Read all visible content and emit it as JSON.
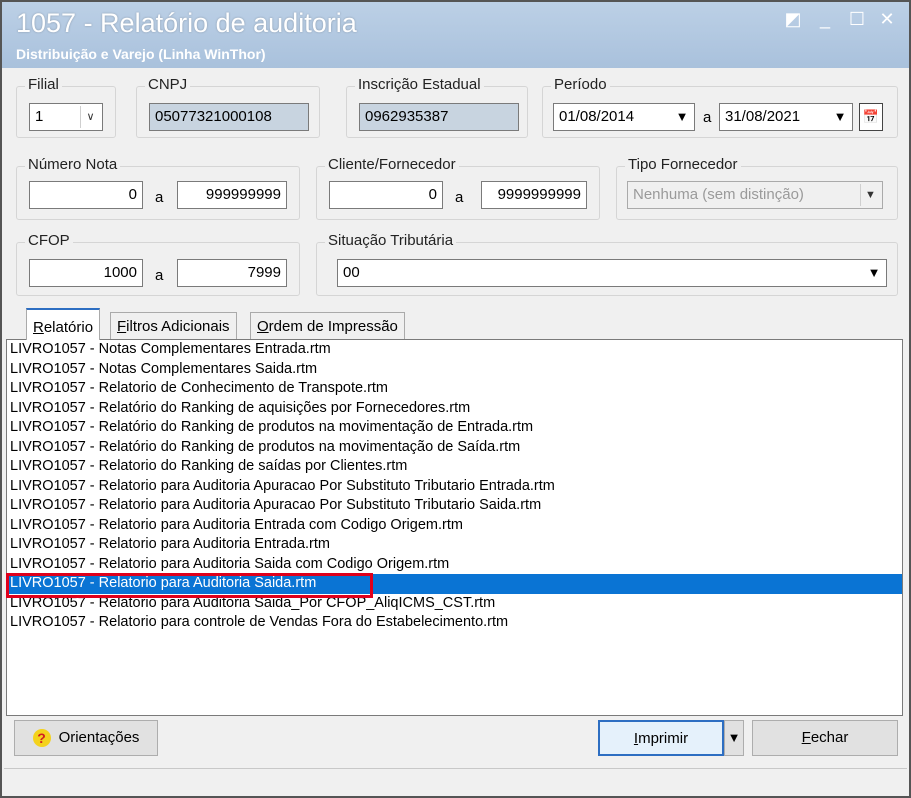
{
  "window": {
    "title": "1057 - Relatório de auditoria",
    "subtitle": "Distribuição e Varejo (Linha WinThor)"
  },
  "filial": {
    "label": "Filial",
    "value": "1"
  },
  "cnpj": {
    "label": "CNPJ",
    "value": "05077321000108"
  },
  "inscricao": {
    "label": "Inscrição Estadual",
    "value": "0962935387"
  },
  "periodo": {
    "label": "Período",
    "start": "01/08/2014",
    "sep": "a",
    "end": "31/08/2021"
  },
  "numero_nota": {
    "label": "Número Nota",
    "from": "0",
    "sep": "a",
    "to": "999999999"
  },
  "cliente_fornecedor": {
    "label": "Cliente/Fornecedor",
    "from": "0",
    "sep": "a",
    "to": "9999999999"
  },
  "tipo_fornecedor": {
    "label": "Tipo Fornecedor",
    "value": "Nenhuma (sem distinção)"
  },
  "cfop": {
    "label": "CFOP",
    "from": "1000",
    "sep": "a",
    "to": "7999"
  },
  "situacao_tributaria": {
    "label": "Situação Tributária",
    "value": "00"
  },
  "tabs": {
    "relatorio_first": "R",
    "relatorio_rest": "elatório",
    "filtros_first": "F",
    "filtros_rest": "iltros Adicionais",
    "ordem_first": "O",
    "ordem_rest": "rdem de Impressão"
  },
  "reports": [
    "LIVRO1057 - Notas Complementares Entrada.rtm",
    "LIVRO1057 - Notas Complementares Saida.rtm",
    "LIVRO1057 - Relatorio de Conhecimento de Transpote.rtm",
    "LIVRO1057 - Relatório do Ranking de aquisições por Fornecedores.rtm",
    "LIVRO1057 - Relatório do Ranking de produtos na movimentação de Entrada.rtm",
    "LIVRO1057 - Relatório do Ranking de produtos na movimentação de Saída.rtm",
    "LIVRO1057 - Relatorio do Ranking de saídas por Clientes.rtm",
    "LIVRO1057 - Relatorio para Auditoria Apuracao Por Substituto Tributario Entrada.rtm",
    "LIVRO1057 - Relatorio para Auditoria Apuracao Por Substituto Tributario Saida.rtm",
    "LIVRO1057 - Relatorio para Auditoria Entrada com Codigo Origem.rtm",
    "LIVRO1057 - Relatorio para Auditoria Entrada.rtm",
    "LIVRO1057 - Relatorio para Auditoria Saida com Codigo Origem.rtm",
    "LIVRO1057 - Relatorio para Auditoria Saida.rtm",
    "LIVRO1057 - Relatorio para Auditoria Saida_Por CFOP_AliqICMS_CST.rtm",
    "LIVRO1057 - Relatorio para controle  de Vendas Fora do Estabelecimento.rtm"
  ],
  "selected_report": 12,
  "buttons": {
    "orientacoes": "Orientações",
    "imprimir_first": "I",
    "imprimir_rest": "mprimir",
    "fechar_first": "F",
    "fechar_rest": "echar"
  },
  "colors": {
    "selection": "#0a74d4",
    "highlight": "#e0001b",
    "titlebar": "#a9c1dc"
  }
}
